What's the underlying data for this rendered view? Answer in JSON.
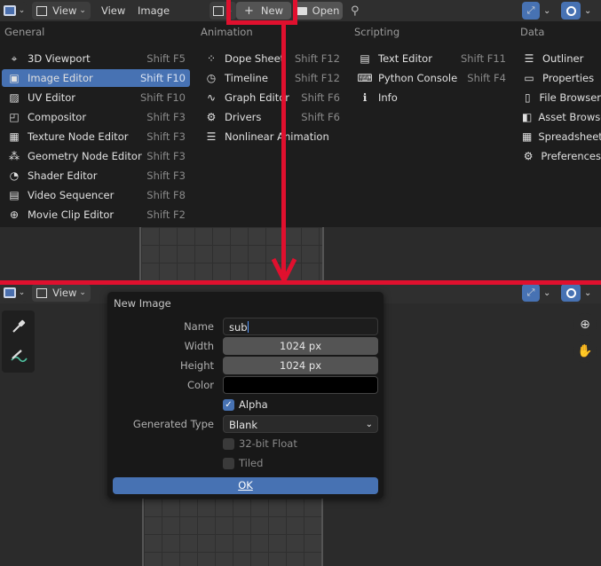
{
  "top_header": {
    "menu_view": "View",
    "menu_view2": "View",
    "menu_image": "Image",
    "new_label": "New",
    "open_label": "Open"
  },
  "editor_menu": {
    "columns": [
      {
        "title": "General",
        "items": [
          {
            "label": "3D Viewport",
            "shortcut": "Shift F5",
            "icon": "viewport-3d-icon",
            "glyph": "⌖"
          },
          {
            "label": "Image Editor",
            "shortcut": "Shift F10",
            "icon": "image-editor-icon",
            "glyph": "▣"
          },
          {
            "label": "UV Editor",
            "shortcut": "Shift F10",
            "icon": "uv-editor-icon",
            "glyph": "▨"
          },
          {
            "label": "Compositor",
            "shortcut": "Shift F3",
            "icon": "compositor-icon",
            "glyph": "◰"
          },
          {
            "label": "Texture Node Editor",
            "shortcut": "Shift F3",
            "icon": "texture-node-icon",
            "glyph": "▦"
          },
          {
            "label": "Geometry Node Editor",
            "shortcut": "Shift F3",
            "icon": "geometry-node-icon",
            "glyph": "⁂"
          },
          {
            "label": "Shader Editor",
            "shortcut": "Shift F3",
            "icon": "shader-editor-icon",
            "glyph": "◔"
          },
          {
            "label": "Video Sequencer",
            "shortcut": "Shift F8",
            "icon": "video-sequencer-icon",
            "glyph": "▤"
          },
          {
            "label": "Movie Clip Editor",
            "shortcut": "Shift F2",
            "icon": "movie-clip-icon",
            "glyph": "⊕"
          }
        ]
      },
      {
        "title": "Animation",
        "items": [
          {
            "label": "Dope Sheet",
            "shortcut": "Shift F12",
            "icon": "dope-sheet-icon",
            "glyph": "⁘"
          },
          {
            "label": "Timeline",
            "shortcut": "Shift F12",
            "icon": "timeline-icon",
            "glyph": "◷"
          },
          {
            "label": "Graph Editor",
            "shortcut": "Shift F6",
            "icon": "graph-editor-icon",
            "glyph": "∿"
          },
          {
            "label": "Drivers",
            "shortcut": "Shift F6",
            "icon": "drivers-icon",
            "glyph": "⚙"
          },
          {
            "label": "Nonlinear Animation",
            "shortcut": "",
            "icon": "nla-icon",
            "glyph": "☰"
          }
        ]
      },
      {
        "title": "Scripting",
        "items": [
          {
            "label": "Text Editor",
            "shortcut": "Shift F11",
            "icon": "text-editor-icon",
            "glyph": "▤"
          },
          {
            "label": "Python Console",
            "shortcut": "Shift F4",
            "icon": "python-console-icon",
            "glyph": "⌨"
          },
          {
            "label": "Info",
            "shortcut": "",
            "icon": "info-icon",
            "glyph": "ℹ"
          }
        ]
      },
      {
        "title": "Data",
        "items": [
          {
            "label": "Outliner",
            "shortcut": "",
            "icon": "outliner-icon",
            "glyph": "☰"
          },
          {
            "label": "Properties",
            "shortcut": "",
            "icon": "properties-icon",
            "glyph": "▭"
          },
          {
            "label": "File Browser",
            "shortcut": "",
            "icon": "file-browser-icon",
            "glyph": "▯"
          },
          {
            "label": "Asset Browser",
            "shortcut": "",
            "icon": "asset-browser-icon",
            "glyph": "◧"
          },
          {
            "label": "Spreadsheet",
            "shortcut": "",
            "icon": "spreadsheet-icon",
            "glyph": "▦"
          },
          {
            "label": "Preferences",
            "shortcut": "",
            "icon": "preferences-icon",
            "glyph": "⚙"
          }
        ]
      }
    ]
  },
  "bottom_header": {
    "menu_view": "View"
  },
  "dialog": {
    "title": "New Image",
    "name_label": "Name",
    "name_value": "sub",
    "width_label": "Width",
    "width_value": "1024 px",
    "height_label": "Height",
    "height_value": "1024 px",
    "color_label": "Color",
    "alpha_label": "Alpha",
    "alpha_checked": true,
    "generated_type_label": "Generated Type",
    "generated_type_value": "Blank",
    "float_label": "32-bit Float",
    "tiled_label": "Tiled",
    "ok_label": "OK"
  },
  "colors": {
    "selection": "#4772b3",
    "annotation": "#e0102e",
    "ok_button": "#4772b3"
  }
}
